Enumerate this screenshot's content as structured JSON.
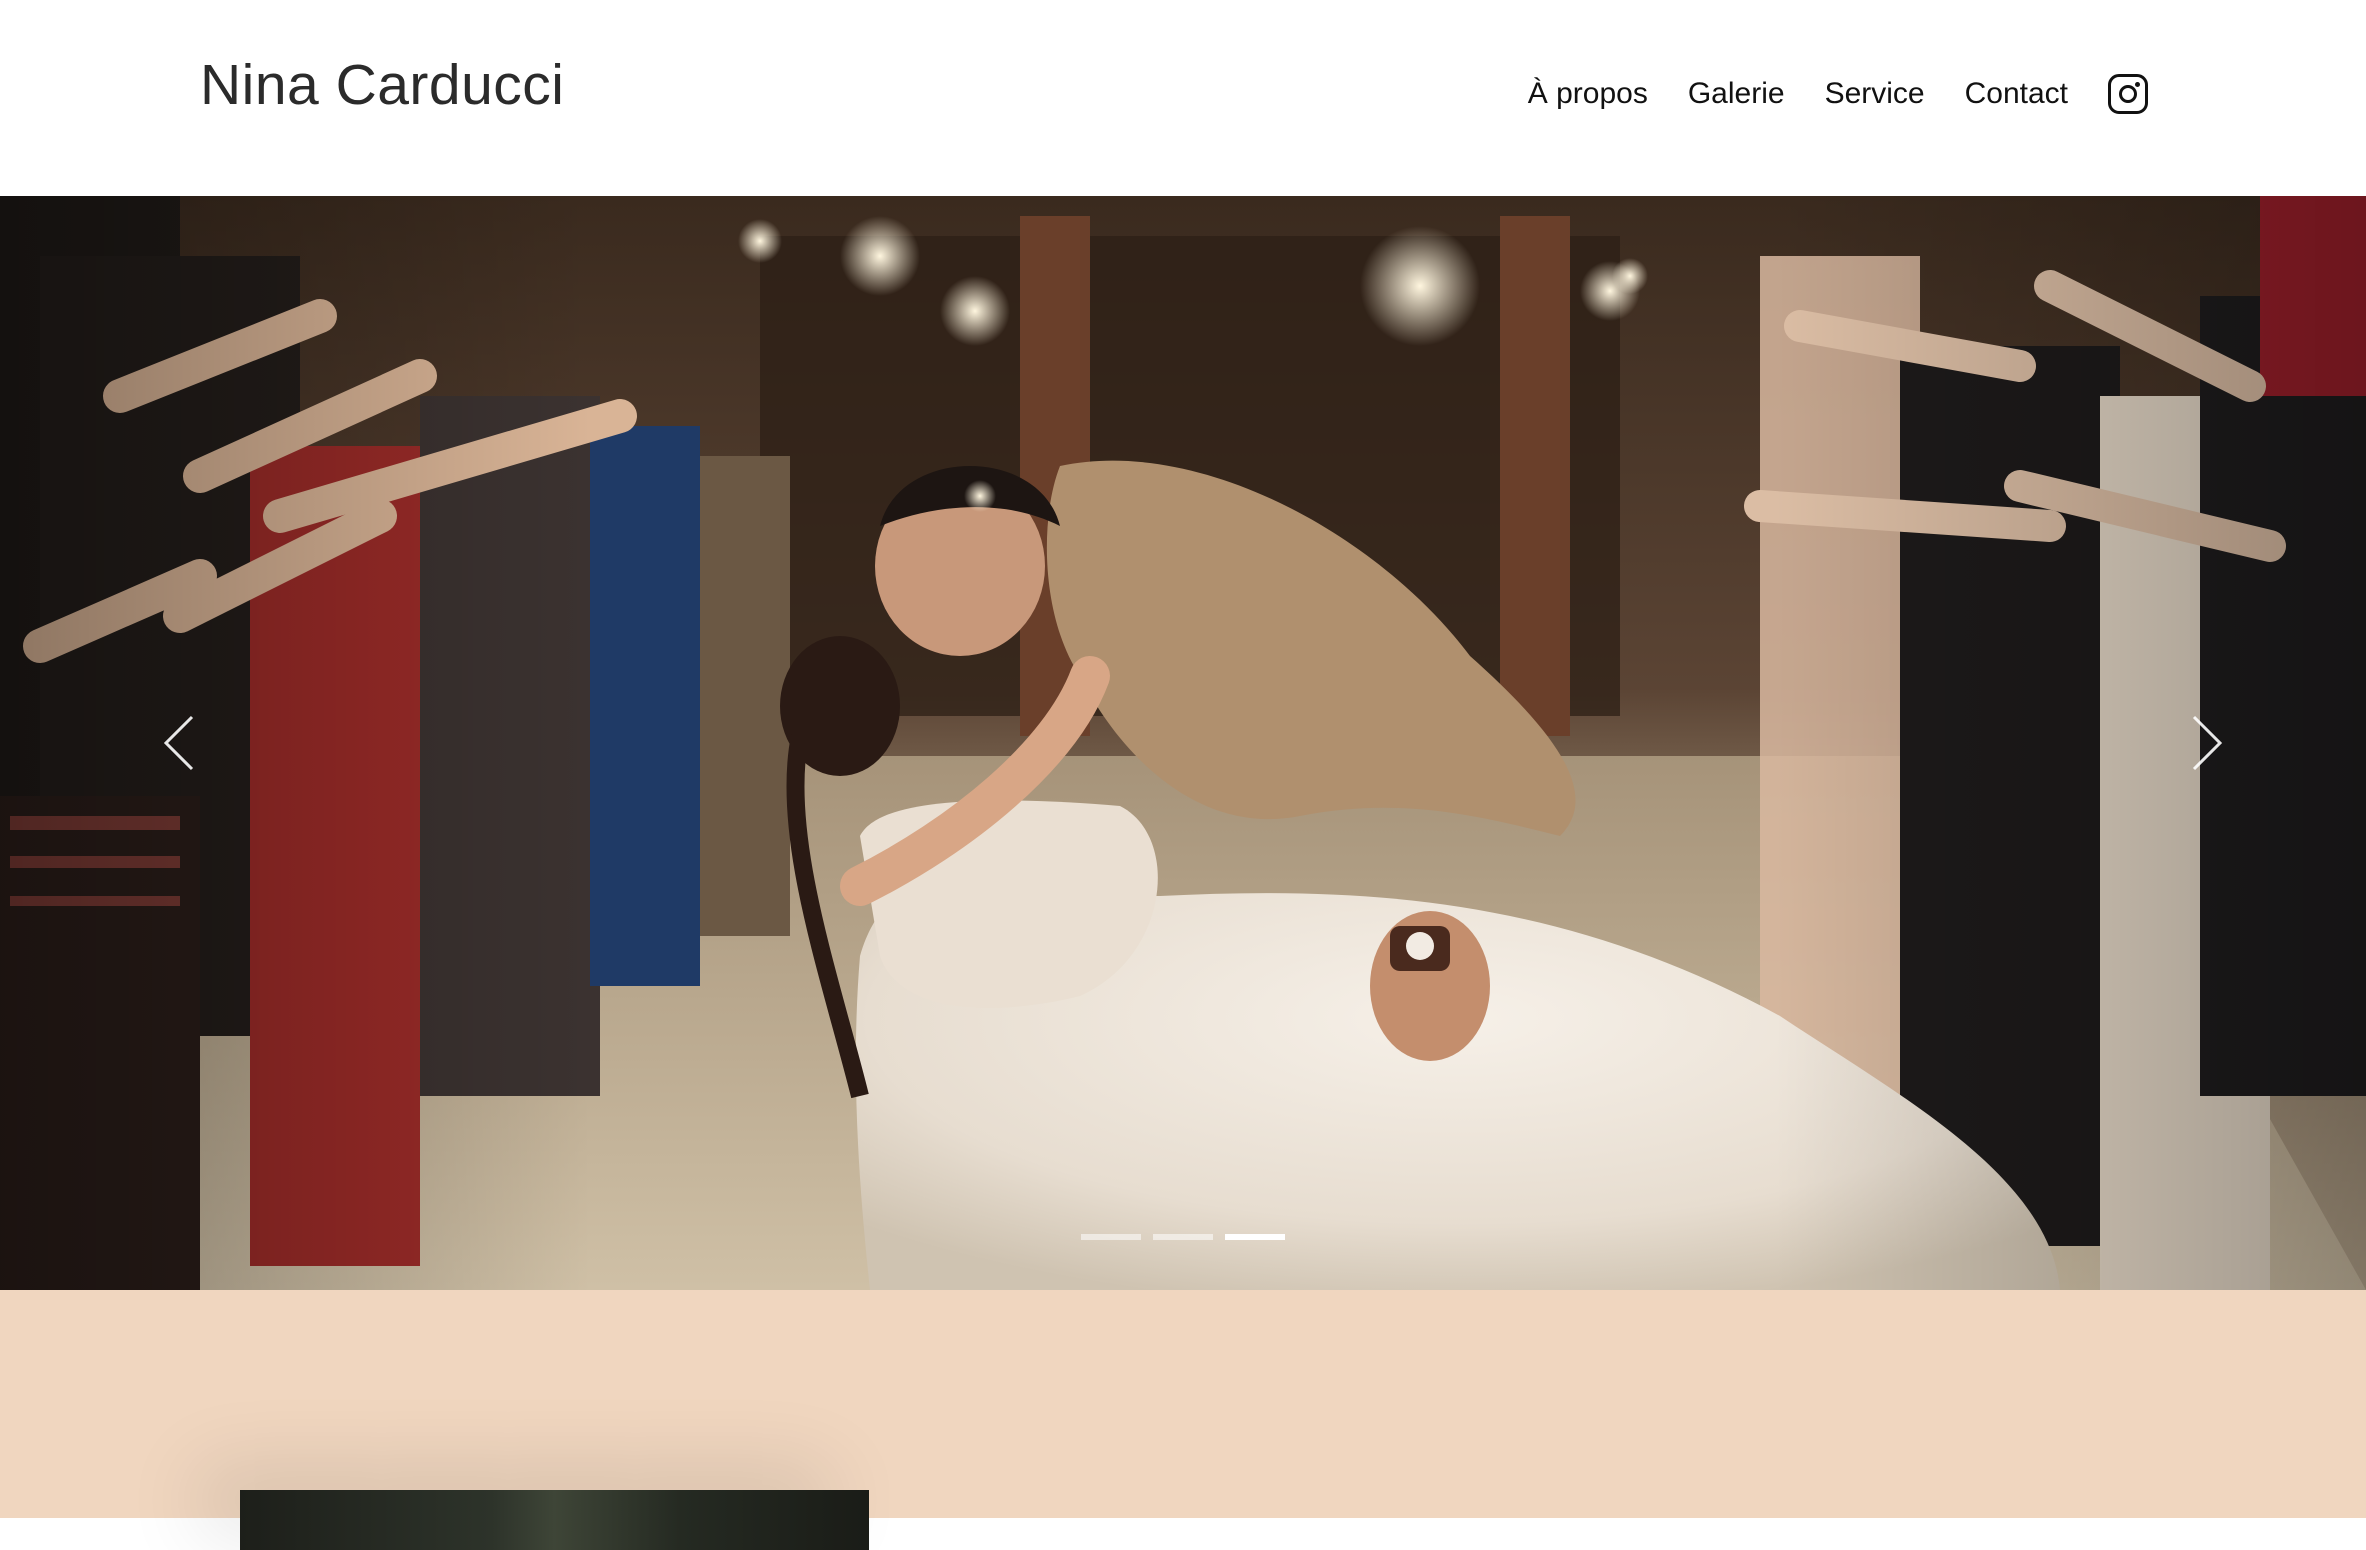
{
  "site": {
    "brand": "Nina Carducci"
  },
  "nav": {
    "items": [
      {
        "label": "À propos"
      },
      {
        "label": "Galerie"
      },
      {
        "label": "Service"
      },
      {
        "label": "Contact"
      }
    ],
    "instagram_icon": "instagram-icon"
  },
  "carousel": {
    "slide_image": "wedding-couple-kiss-sparklers",
    "slide_count": 3,
    "active_index": 2,
    "prev_icon": "chevron-left-icon",
    "next_icon": "chevron-right-icon"
  },
  "colors": {
    "about_background": "#f0d6bf",
    "text": "#222222"
  }
}
